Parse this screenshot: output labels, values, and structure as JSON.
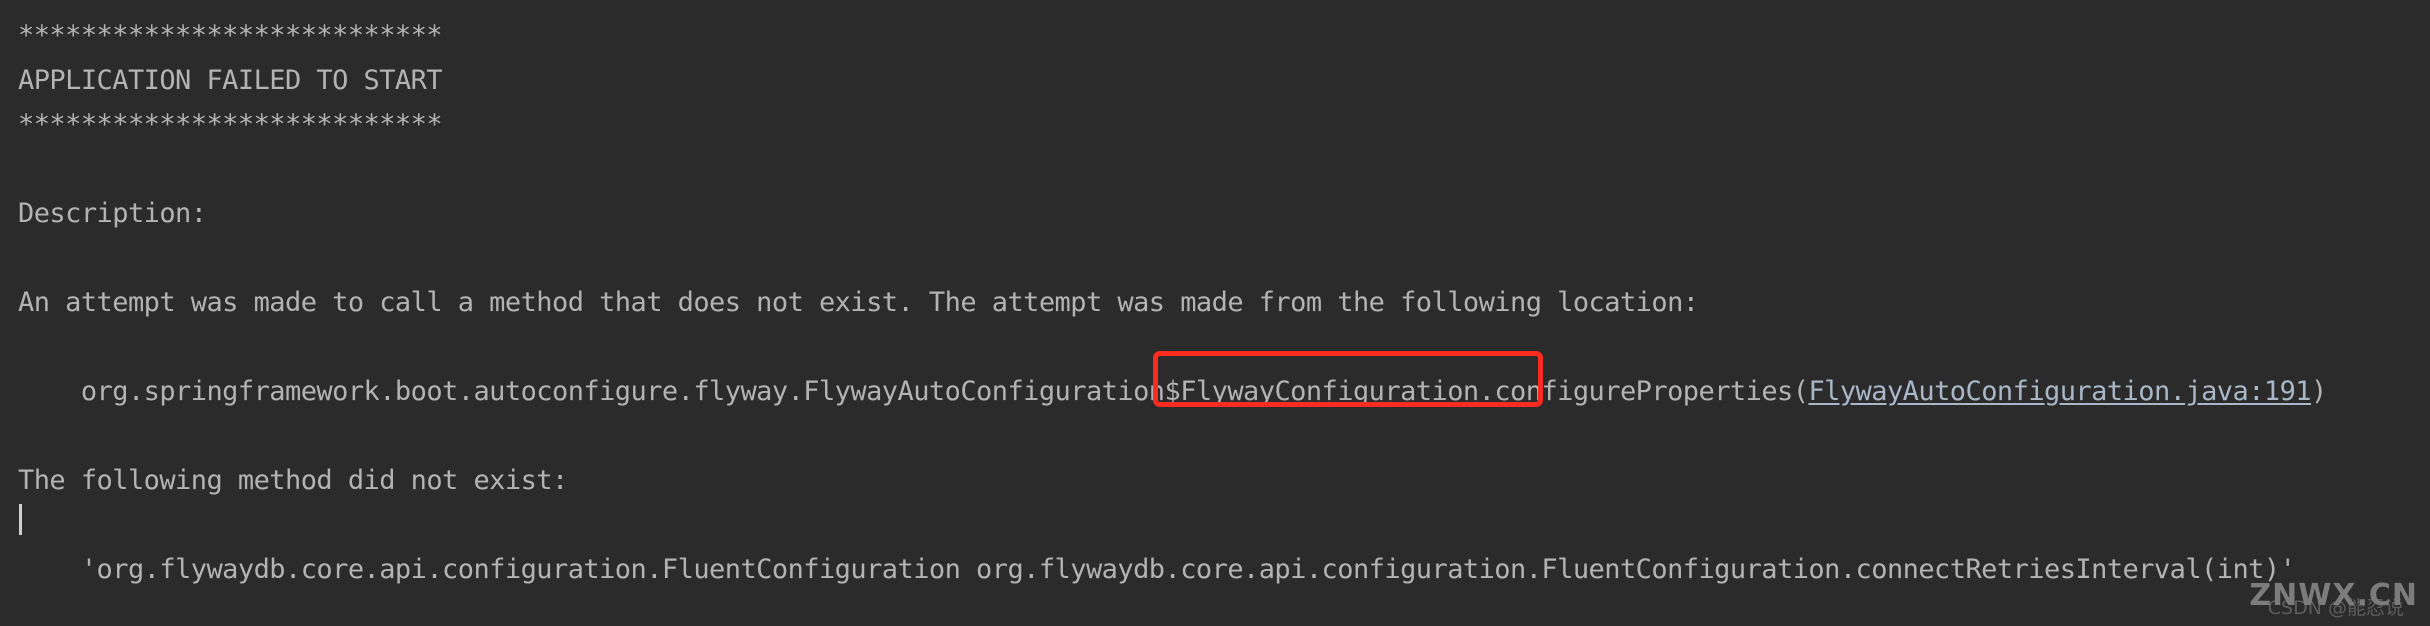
{
  "console": {
    "background_color": "#2b2b2b",
    "text_color": "#b3b3b3",
    "banner_rule": "***************************",
    "title_line": "APPLICATION FAILED TO START",
    "lines": [
      {
        "id": "rule-top",
        "text": "***************************"
      },
      {
        "id": "title",
        "text": "APPLICATION FAILED TO START"
      },
      {
        "id": "rule-bottom",
        "text": "***************************"
      },
      {
        "id": "blank-1",
        "text": " "
      },
      {
        "id": "description-label",
        "text": "Description:"
      },
      {
        "id": "blank-2",
        "text": " "
      },
      {
        "id": "description-body",
        "text": "An attempt was made to call a method that does not exist. The attempt was made from the following location:"
      },
      {
        "id": "blank-3",
        "text": " "
      }
    ],
    "stack_trace": {
      "indent": "    ",
      "prefix": "org.springframework.boot.autoconfigure.flyway.FlywayAutoConfiguratio",
      "highlighted": "n$FlywayConfiguration.c",
      "suffix": "onfigureProperties(",
      "link": "FlywayAutoConfiguration.java:191",
      "close_paren": ")"
    },
    "blank_after_trace": " ",
    "method_label": "The following method did not exist:",
    "blank_after_label": " ",
    "missing_method": "    'org.flywaydb.core.api.configuration.FluentConfiguration org.flywaydb.core.api.configuration.FluentConfiguration.connectRetriesInterval(int)'"
  },
  "annotation": {
    "highlight_color": "#fc2d20",
    "highlight_target": "n$FlywayConfiguration.c"
  },
  "watermark": {
    "primary": "ZNWX.CN",
    "secondary": "CSDN @能忍说"
  }
}
